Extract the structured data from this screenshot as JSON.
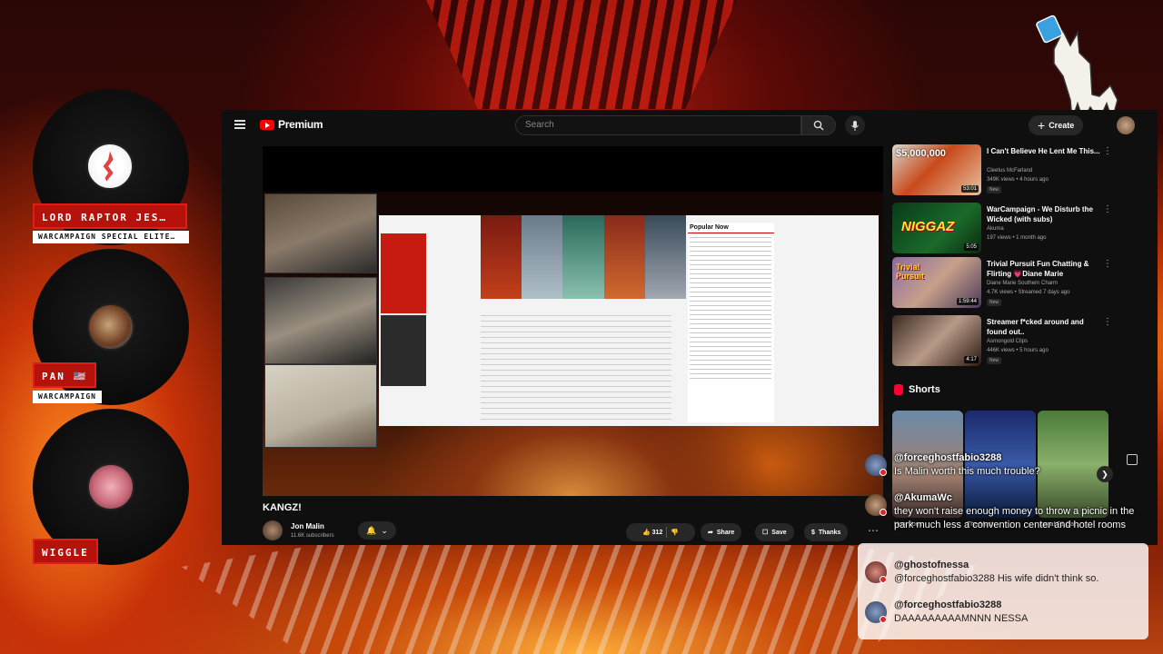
{
  "participants": [
    {
      "name": "LORD RAPTOR JES…",
      "subtitle": "WARCAMPAIGN SPECIAL ELITE…"
    },
    {
      "name": "PAN 🇺🇸",
      "subtitle": "WARCAMPAIGN"
    },
    {
      "name": "WIGGLE",
      "subtitle": ""
    }
  ],
  "youtube": {
    "logo": "Premium",
    "search_placeholder": "Search",
    "create_label": "Create",
    "article_sidebar_title": "Popular Now",
    "video": {
      "title": "KANGZ!",
      "channel": "Jon Malin",
      "subscribers": "11.6K subscribers",
      "likes": "312",
      "share": "Share",
      "save": "Save",
      "thanks": "Thanks"
    },
    "recommended": [
      {
        "title": "I Can't Believe He Lent Me This...",
        "channel": "Cleetus McFarland",
        "meta": "349K views • 4 hours ago",
        "badge": "New",
        "duration": "53:01",
        "thumb_text": "$5,000,000"
      },
      {
        "title": "WarCampaign - We Disturb the Wicked (with subs)",
        "channel": "Akuma",
        "meta": "197 views • 1 month ago",
        "badge": "",
        "duration": "5:05",
        "thumb_text": "NIGGAZ"
      },
      {
        "title": "Trivial Pursuit Fun Chatting & Flirting 💗Diane Marie",
        "channel": "Diane Marie Southern Charm",
        "meta": "4.7K views • Streamed 7 days ago",
        "badge": "New",
        "duration": "1:59:44",
        "thumb_text": "Trivia! Pursuit"
      },
      {
        "title": "Streamer f*cked around and found out..",
        "channel": "Asmongold Clips",
        "meta": "446K views • 5 hours ago",
        "badge": "New",
        "duration": "4:17",
        "thumb_text": ""
      }
    ],
    "shorts_title": "Shorts",
    "shorts": [
      {
        "label": "How does"
      },
      {
        "label": "The Most"
      },
      {
        "label": "Legal F1 Ca…"
      }
    ]
  },
  "chat": [
    {
      "user": "@forceghostfabio3288",
      "text": "Is Malin worth this much trouble?"
    },
    {
      "user": "@AkumaWc",
      "text": "they won't raise enough money to throw a picnic in the park much less a convention center and hotel rooms"
    },
    {
      "user": "@ghostofnessa",
      "text": "@forceghostfabio3288 His wife didn't think so."
    },
    {
      "user": "@forceghostfabio3288",
      "text": "DAAAAAAAAAMNNN NESSA"
    }
  ],
  "colors": {
    "badge_red": "#b5120b",
    "youtube_red": "#ff0000",
    "yt_bg": "#0f0f0f"
  }
}
